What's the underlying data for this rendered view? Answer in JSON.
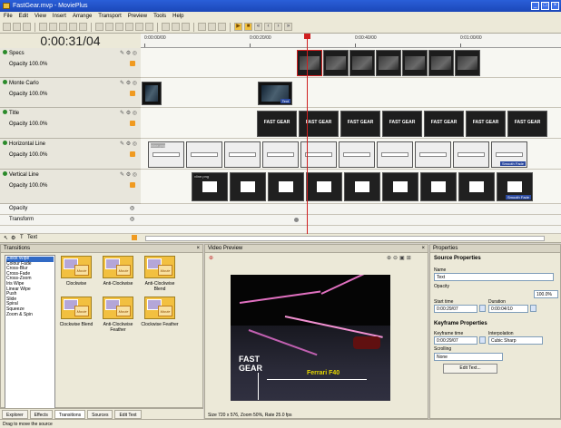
{
  "app": {
    "title": "FastGear.mvp - MoviePlus"
  },
  "menu": [
    "File",
    "Edit",
    "View",
    "Insert",
    "Arrange",
    "Transport",
    "Preview",
    "Tools",
    "Help"
  ],
  "timeline": {
    "timecode": "0:00:31/04",
    "ruler": [
      "0:00:00/00",
      "0:00:20/00",
      "0:00:40/00",
      "0:01:00/00"
    ],
    "tracks": [
      {
        "name": "Specs",
        "opacity": "Opacity 100.0%"
      },
      {
        "name": "Monte Carlo",
        "opacity": "Opacity 100.0%"
      },
      {
        "name": "Title",
        "opacity": "Opacity 100.0%"
      },
      {
        "name": "Horizontal Line",
        "opacity": "Opacity 100.0%"
      },
      {
        "name": "Vertical Line",
        "opacity": "Opacity 100.0%"
      }
    ],
    "property_rows": [
      "Opacity",
      "Transform"
    ],
    "text_track": "Text",
    "clips": {
      "title_text": "FAST GEAR",
      "hline_label": "hline.png",
      "vline_label": "vline.png",
      "text_label": "Text",
      "smooth_fade": "Smooth Fade"
    }
  },
  "transitions": {
    "header": "Transitions",
    "list": [
      "Clock Wipe",
      "Colour Fade",
      "Cross-Blur",
      "Cross-Fade",
      "Cross-Zoom",
      "Iris Wipe",
      "Linear Wipe",
      "Push",
      "Slide",
      "Spiral",
      "Squeeze",
      "Zoom & Spin"
    ],
    "selected": "Clock Wipe",
    "items": [
      "Clockwise",
      "Anti-Clockwise",
      "Anti-Clockwise Blend",
      "Clockwise Blend",
      "Anti-Clockwise Feather",
      "Clockwise Feather"
    ],
    "thumb_text": "Movie"
  },
  "tabs": [
    "Explorer",
    "Effects",
    "Transitions",
    "Sources",
    "Edit Text"
  ],
  "preview": {
    "header": "Video Preview",
    "line1": "FAST",
    "line2": "GEAR",
    "caption": "Ferrari F40",
    "status": "Size 720 x 576, Zoom 50%, Rate 25.0 fps"
  },
  "properties": {
    "header": "Properties",
    "source_title": "Source Properties",
    "name_label": "Name",
    "name_value": "Text",
    "opacity_label": "Opacity",
    "opacity_value": "100.0%",
    "start_label": "Start time",
    "start_value": "0:00:29/07",
    "duration_label": "Duration",
    "duration_value": "0:00:04/10",
    "kf_title": "Keyframe Properties",
    "kf_time_label": "Keyframe time",
    "kf_time_value": "0:00:29/07",
    "interp_label": "Interpolation",
    "interp_value": "Cubic Sharp",
    "scrolling_label": "Scrolling",
    "scrolling_value": "None",
    "edit_button": "Edit Text..."
  },
  "statusbar": "Drag to move the source"
}
